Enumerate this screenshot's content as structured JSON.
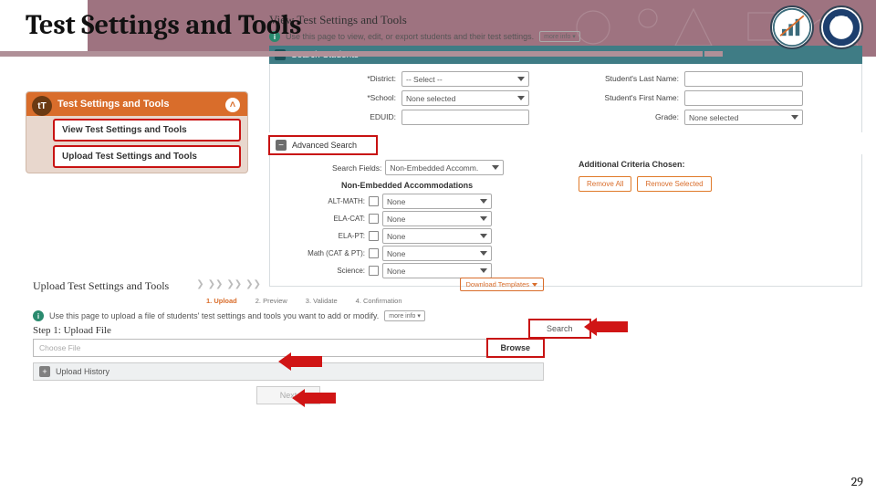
{
  "slide": {
    "title": "Test Settings and Tools",
    "pageNumber": "29"
  },
  "nav": {
    "header": "Test Settings and Tools",
    "iconLabel": "tT",
    "items": [
      {
        "label": "View Test Settings and Tools"
      },
      {
        "label": "Upload Test Settings and Tools"
      }
    ]
  },
  "view": {
    "title": "View Test Settings and Tools",
    "infoText": "Use this page to view, edit, or export students and their test settings.",
    "moreInfo": "more info ▾",
    "searchStudents": "Search Students",
    "fields": {
      "district": "*District:",
      "districtVal": "-- Select --",
      "school": "*School:",
      "schoolVal": "None selected",
      "eduid": "EDUID:",
      "lastName": "Student's Last Name:",
      "firstName": "Student's First Name:",
      "grade": "Grade:",
      "gradeVal": "None selected"
    },
    "advanced": {
      "title": "Advanced Search",
      "searchFields": "Search Fields:",
      "searchFieldsVal": "Non-Embedded Accomm.",
      "neTitle": "Non-Embedded Accommodations",
      "rows": [
        {
          "label": "ALT-MATH:",
          "val": "None"
        },
        {
          "label": "ELA-CAT:",
          "val": "None"
        },
        {
          "label": "ELA-PT:",
          "val": "None"
        },
        {
          "label": "Math (CAT & PT):",
          "val": "None"
        },
        {
          "label": "Science:",
          "val": "None"
        }
      ],
      "accTitle": "Additional Criteria Chosen:",
      "removeAll": "Remove All",
      "removeSelected": "Remove Selected"
    },
    "searchBtn": "Search"
  },
  "upload": {
    "title": "Upload Test Settings and Tools",
    "steps": {
      "s1": "1. Upload",
      "s2": "2. Preview",
      "s3": "3. Validate",
      "s4": "4. Confirmation"
    },
    "downloadTemplates": "Download Templates",
    "infoText": "Use this page to upload a file of students' test settings and tools you want to add or modify.",
    "moreInfo": "more info ▾",
    "step1": "Step 1: Upload File",
    "chooseFile": "Choose File",
    "browse": "Browse",
    "uploadHistory": "Upload History",
    "next": "Next"
  }
}
